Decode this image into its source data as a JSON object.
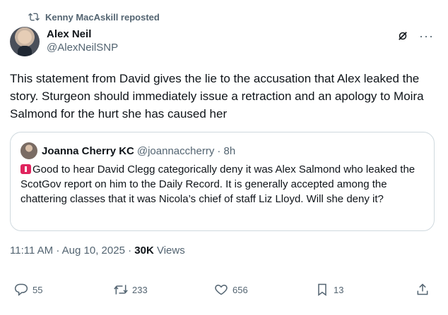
{
  "repost": {
    "text": "Kenny MacAskill reposted"
  },
  "author": {
    "name": "Alex Neil",
    "handle": "@AlexNeilSNP"
  },
  "tweet": {
    "text": "This statement from David gives the lie to the accusation that Alex leaked the story. Sturgeon should immediately issue a retraction and an apology to Moira Salmond for the hurt she has caused her"
  },
  "quote": {
    "name": "Joanna Cherry KC",
    "handle": "@joannaccherry",
    "time": "· 8h",
    "text": "Good to hear David Clegg categorically deny it was Alex Salmond who leaked the ScotGov report on him to the Daily Record. It is generally accepted among the chattering classes that it was Nicola’s chief of staff Liz Lloyd. Will she deny it?"
  },
  "meta": {
    "time": "11:11 AM",
    "date": "Aug 10, 2025",
    "views_count": "30K",
    "views_label": "Views"
  },
  "actions": {
    "replies": "55",
    "reposts": "233",
    "likes": "656",
    "bookmarks": "13"
  },
  "icons": [
    "repost-icon",
    "grok-icon",
    "more-icon",
    "reply-icon",
    "like-icon",
    "bookmark-icon",
    "share-icon",
    "siren-icon"
  ],
  "colors": {
    "text": "#0f1419",
    "muted": "#536471",
    "border": "#cfd9de"
  }
}
